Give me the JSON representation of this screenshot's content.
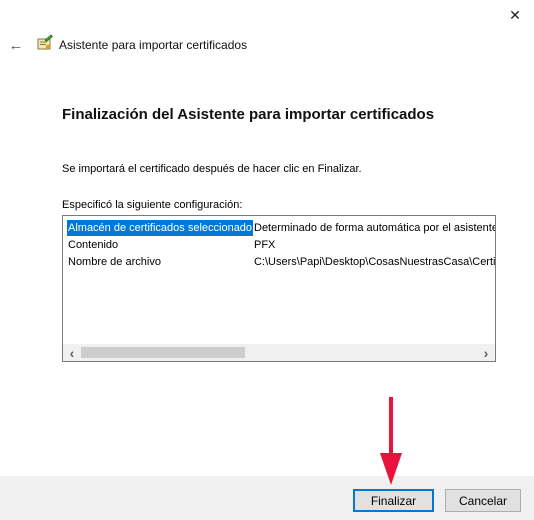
{
  "window": {
    "title": "Asistente para importar certificados",
    "close_glyph": "✕",
    "back_glyph": "←"
  },
  "content": {
    "heading": "Finalización del Asistente para importar certificados",
    "description": "Se importará el certificado después de hacer clic en Finalizar.",
    "config_label": "Especificó la siguiente configuración:"
  },
  "settings_table": {
    "rows": [
      {
        "setting": "Almacén de certificados seleccionado",
        "value": "Determinado de forma automática por el asistente",
        "selected": true
      },
      {
        "setting": "Contenido",
        "value": "PFX",
        "selected": false
      },
      {
        "setting": "Nombre de archivo",
        "value": "C:\\Users\\Papi\\Desktop\\CosasNuestrasCasa\\Certif",
        "selected": false
      }
    ],
    "scroll_left_glyph": "‹",
    "scroll_right_glyph": "›"
  },
  "buttons": {
    "finish": "Finalizar",
    "cancel": "Cancelar"
  },
  "colors": {
    "selection": "#0078d7",
    "annotation_arrow": "#e8123a"
  }
}
